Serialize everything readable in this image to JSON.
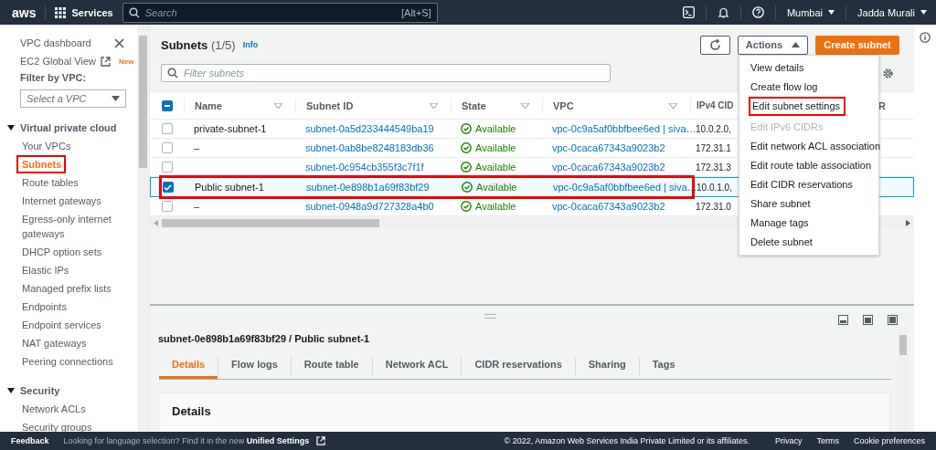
{
  "topbar": {
    "logo": "aws",
    "services": "Services",
    "search": {
      "placeholder": "Search",
      "shortcut": "[Alt+S]"
    },
    "region": "Mumbai",
    "user": "Jadda Murali"
  },
  "sidebar": {
    "top_links": [
      {
        "label": "VPC dashboard"
      },
      {
        "label": "EC2 Global View",
        "badge": "New"
      }
    ],
    "filter_label": "Filter by VPC:",
    "filter_select": {
      "placeholder": "Select a VPC"
    },
    "sections": [
      {
        "title": "Virtual private cloud",
        "expanded": true,
        "items": [
          {
            "label": "Your VPCs",
            "selected": false,
            "highlighted": false
          },
          {
            "label": "Subnets",
            "selected": true,
            "highlighted": true
          },
          {
            "label": "Route tables",
            "selected": false,
            "highlighted": false
          },
          {
            "label": "Internet gateways",
            "selected": false,
            "highlighted": false
          },
          {
            "label": "Egress-only internet gateways",
            "selected": false,
            "highlighted": false
          },
          {
            "label": "DHCP option sets",
            "selected": false,
            "highlighted": false
          },
          {
            "label": "Elastic IPs",
            "selected": false,
            "highlighted": false
          },
          {
            "label": "Managed prefix lists",
            "selected": false,
            "highlighted": false
          },
          {
            "label": "Endpoints",
            "selected": false,
            "highlighted": false
          },
          {
            "label": "Endpoint services",
            "selected": false,
            "highlighted": false
          },
          {
            "label": "NAT gateways",
            "selected": false,
            "highlighted": false
          },
          {
            "label": "Peering connections",
            "selected": false,
            "highlighted": false
          }
        ]
      },
      {
        "title": "Security",
        "expanded": true,
        "items": [
          {
            "label": "Network ACLs",
            "selected": false,
            "highlighted": false
          },
          {
            "label": "Security groups",
            "selected": false,
            "highlighted": false
          }
        ]
      }
    ]
  },
  "header": {
    "title": "Subnets",
    "count": "(1/5)",
    "info": "Info",
    "actions": "Actions",
    "create": "Create subnet"
  },
  "filter": {
    "placeholder": "Filter subnets"
  },
  "table": {
    "select_all": {
      "indeterminate": true
    },
    "columns": [
      "Name",
      "Subnet ID",
      "State",
      "VPC",
      "IPv4 CID",
      "R"
    ],
    "rows": [
      {
        "name": "private-subnet-1",
        "subnet_id": "subnet-0a5d233444549ba19",
        "state": "Available",
        "vpc": "vpc-0c9a5af0bbfbee6ed | siva…",
        "ipv4": "10.0.2.0,",
        "selected": false,
        "highlighted": false
      },
      {
        "name": "–",
        "subnet_id": "subnet-0ab8be8248183db36",
        "state": "Available",
        "vpc": "vpc-0caca67343a9023b2",
        "ipv4": "172.31.1",
        "selected": false,
        "highlighted": false
      },
      {
        "name": "",
        "subnet_id": "subnet-0c954cb355f3c7f1f",
        "state": "Available",
        "vpc": "vpc-0caca67343a9023b2",
        "ipv4": "172.31.3",
        "selected": false,
        "highlighted": false
      },
      {
        "name": "Public subnet-1",
        "subnet_id": "subnet-0e898b1a69f83bf29",
        "state": "Available",
        "vpc": "vpc-0c9a5af0bbfbee6ed | siva…",
        "ipv4": "10.0.1.0,",
        "selected": true,
        "highlighted": true
      },
      {
        "name": "–",
        "subnet_id": "subnet-0948a9d727328a4b0",
        "state": "Available",
        "vpc": "vpc-0caca67343a9023b2",
        "ipv4": "172.31.0",
        "selected": false,
        "highlighted": false
      }
    ]
  },
  "actions_menu": {
    "open": true,
    "items": [
      {
        "label": "View details",
        "disabled": false,
        "highlighted": false
      },
      {
        "label": "Create flow log",
        "disabled": false,
        "highlighted": false
      },
      {
        "label": "Edit subnet settings",
        "disabled": false,
        "highlighted": true
      },
      {
        "label": "Edit IPv6 CIDRs",
        "disabled": true,
        "highlighted": false
      },
      {
        "label": "Edit network ACL association",
        "disabled": false,
        "highlighted": false
      },
      {
        "label": "Edit route table association",
        "disabled": false,
        "highlighted": false
      },
      {
        "label": "Edit CIDR reservations",
        "disabled": false,
        "highlighted": false
      },
      {
        "label": "Share subnet",
        "disabled": false,
        "highlighted": false
      },
      {
        "label": "Manage tags",
        "disabled": false,
        "highlighted": false
      },
      {
        "label": "Delete subnet",
        "disabled": false,
        "highlighted": false
      }
    ]
  },
  "detail": {
    "title": "subnet-0e898b1a69f83bf29 / Public subnet-1",
    "tabs": [
      {
        "label": "Details",
        "selected": true
      },
      {
        "label": "Flow logs",
        "selected": false
      },
      {
        "label": "Route table",
        "selected": false
      },
      {
        "label": "Network ACL",
        "selected": false
      },
      {
        "label": "CIDR reservations",
        "selected": false
      },
      {
        "label": "Sharing",
        "selected": false
      },
      {
        "label": "Tags",
        "selected": false
      }
    ],
    "card_title": "Details"
  },
  "footer": {
    "feedback": "Feedback",
    "notice": "Looking for language selection? Find it in the new **Unified Settings**",
    "copyright": "© 2022, Amazon Web Services India Private Limited or its affiliates.",
    "links": [
      "Privacy",
      "Terms",
      "Cookie preferences"
    ]
  }
}
